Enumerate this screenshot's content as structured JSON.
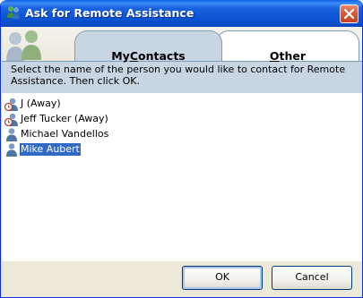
{
  "window": {
    "title": "Ask for Remote Assistance"
  },
  "tabs": [
    {
      "label_pre": "My ",
      "label_ul": "C",
      "label_post": "ontacts",
      "selected": true
    },
    {
      "label_pre": "",
      "label_ul": "O",
      "label_post": "ther",
      "selected": false
    }
  ],
  "instruction": "Select the name of the person you would like to contact for Remote Assistance. Then click OK.",
  "contacts": [
    {
      "name": "J (Away)",
      "icon": "contact-away-icon"
    },
    {
      "name": "Jeff Tucker (Away)",
      "icon": "contact-away-icon"
    },
    {
      "name": "Michael Vandellos",
      "icon": "contact-icon"
    },
    {
      "name": "Mike Aubert",
      "icon": "contact-icon",
      "selected": true
    }
  ],
  "buttons": {
    "ok": "OK",
    "cancel": "Cancel"
  },
  "colors": {
    "titlebar": "#0a5fe8",
    "selection": "#316ac5",
    "tab_active": "#c8d6e3",
    "close": "#d95a38"
  }
}
